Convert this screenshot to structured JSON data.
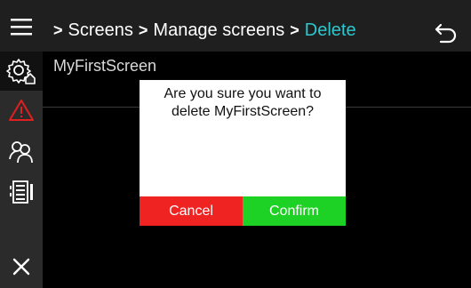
{
  "header": {
    "menu_icon": "hamburger-menu-icon",
    "breadcrumb": {
      "items": [
        "Screens",
        "Manage screens",
        "Delete"
      ],
      "separator": ">",
      "current_color": "#2cc8cf"
    },
    "back_icon": "back-arrow-icon"
  },
  "sidebar": {
    "items": [
      {
        "icon": "settings-home-icon",
        "active": true
      },
      {
        "icon": "warning-triangle-icon",
        "color": "#e02020"
      },
      {
        "icon": "users-icon"
      },
      {
        "icon": "device-list-icon"
      }
    ],
    "close_icon": "close-icon"
  },
  "list": {
    "rows": [
      {
        "label": "MyFirstScreen"
      }
    ]
  },
  "dialog": {
    "message": "Are you sure you want to delete MyFirstScreen?",
    "cancel_label": "Cancel",
    "confirm_label": "Confirm",
    "cancel_color": "#f02323",
    "confirm_color": "#1ed125"
  }
}
